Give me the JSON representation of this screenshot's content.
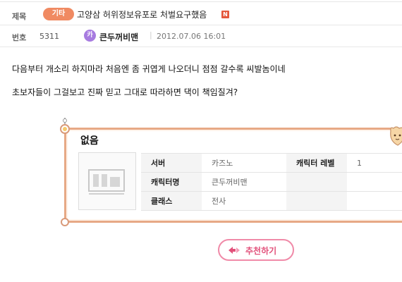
{
  "header": {
    "title_label": "제목",
    "category": "기타",
    "title": "고양삼 허위정보유포로 처벌요구했음",
    "new_badge": "N",
    "number_label": "번호",
    "number": "5311",
    "avatar_letter": "카",
    "author": "큰두꺼비맨",
    "separator": "|",
    "date": "2012.07.06 16:01"
  },
  "body": {
    "paragraphs": [
      "다음부터 개소리 하지마라 처음엔 좀 귀엽게 나오더니 점점 갈수록 씨발놈이네",
      "초보자들이 그걸보고 진짜 믿고 그대로 따라하면 댁이 책임질겨?"
    ]
  },
  "character_card": {
    "name": "없음",
    "rows": [
      {
        "key": "서버",
        "value": "카즈노",
        "key2": "캐릭터 레벨",
        "value2": "1"
      },
      {
        "key": "캐릭터명",
        "value": "큰두꺼비맨"
      },
      {
        "key": "클래스",
        "value": "전사"
      }
    ]
  },
  "actions": {
    "recommend_label": "추천하기"
  },
  "colors": {
    "category_badge": "#f08a62",
    "avatar": "#a77be0",
    "card_border": "#e7a986",
    "recommend_border": "#f08aa8",
    "recommend_text": "#e2507a"
  }
}
